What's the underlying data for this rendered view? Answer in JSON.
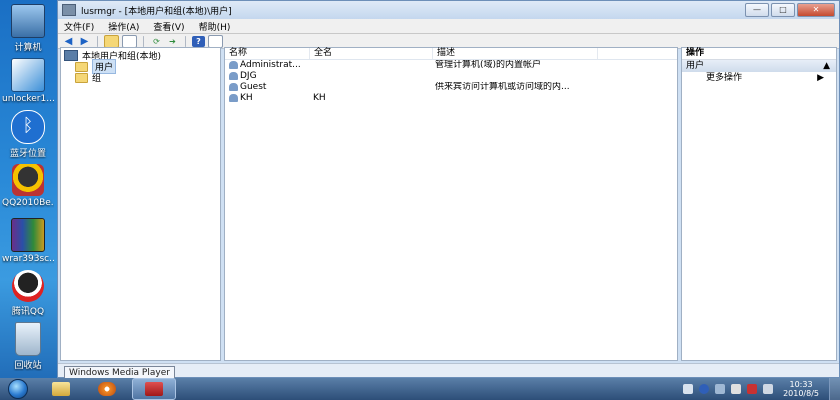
{
  "desktop": {
    "icons": [
      {
        "label": "计算机"
      },
      {
        "label": "unlocker1..."
      },
      {
        "label": "蓝牙位置"
      },
      {
        "label": "QQ2010Be..."
      },
      {
        "label": "wrar393sc..."
      },
      {
        "label": "腾讯QQ"
      },
      {
        "label": "回收站"
      }
    ]
  },
  "window": {
    "title": "lusrmgr - [本地用户和组(本地)\\用户]",
    "buttons": {
      "minimize": "—",
      "maximize": "□",
      "close": "✕"
    }
  },
  "menu": [
    "文件(F)",
    "操作(A)",
    "查看(V)",
    "帮助(H)"
  ],
  "tree": {
    "root": "本地用户和组(本地)",
    "items": [
      {
        "label": "用户",
        "selected": true
      },
      {
        "label": "组",
        "selected": false
      }
    ]
  },
  "list": {
    "columns": [
      "名称",
      "全名",
      "描述"
    ],
    "rows": [
      {
        "name": "Administrat...",
        "fullname": "",
        "description": "管理计算机(域)的内置帐户"
      },
      {
        "name": "DJG",
        "fullname": "",
        "description": ""
      },
      {
        "name": "Guest",
        "fullname": "",
        "description": "供来宾访问计算机或访问域的内..."
      },
      {
        "name": "KH",
        "fullname": "KH",
        "description": ""
      }
    ]
  },
  "actions": {
    "header": "操作",
    "section": "用户",
    "section_arrow": "▲",
    "more": "更多操作",
    "more_arrow": "▶"
  },
  "tooltip": "Windows Media Player",
  "taskbar": {
    "clock_time": "10:33",
    "clock_date": "2010/8/5"
  }
}
